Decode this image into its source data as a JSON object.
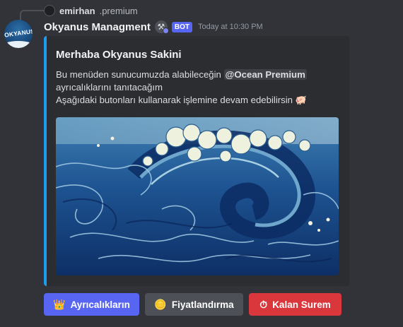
{
  "reply": {
    "username": "emirhan",
    "text": ".premium"
  },
  "message": {
    "author": "Okyanus Managment",
    "avatar_text": "OKYANUS",
    "badge": "BOT",
    "timestamp": "Today at 10:30 PM"
  },
  "embed": {
    "accent_color": "#1b9df0",
    "title": "Merhaba Okyanus Sakini",
    "desc_line1_prefix": "Bu menüden sunucumuzda alabileceğin ",
    "mention": "@Ocean Premium",
    "desc_line2": "ayrıcalıklarını tanıtacağım",
    "desc_line3": "Aşağıdaki butonları kullanarak işlemine devam edebilirsin",
    "desc_emoji": "pig-icon"
  },
  "buttons": [
    {
      "label": "Ayrıcalıkların",
      "icon": "crown-icon",
      "style": "primary"
    },
    {
      "label": "Fiyatlandırma",
      "icon": "coins-icon",
      "style": "secondary"
    },
    {
      "label": "Kalan Surem",
      "icon": "stopwatch-icon",
      "style": "danger"
    }
  ],
  "colors": {
    "background": "#313338",
    "embed_background": "#2b2d31",
    "primary": "#5865f2",
    "secondary": "#4e5058",
    "danger": "#da373c"
  }
}
